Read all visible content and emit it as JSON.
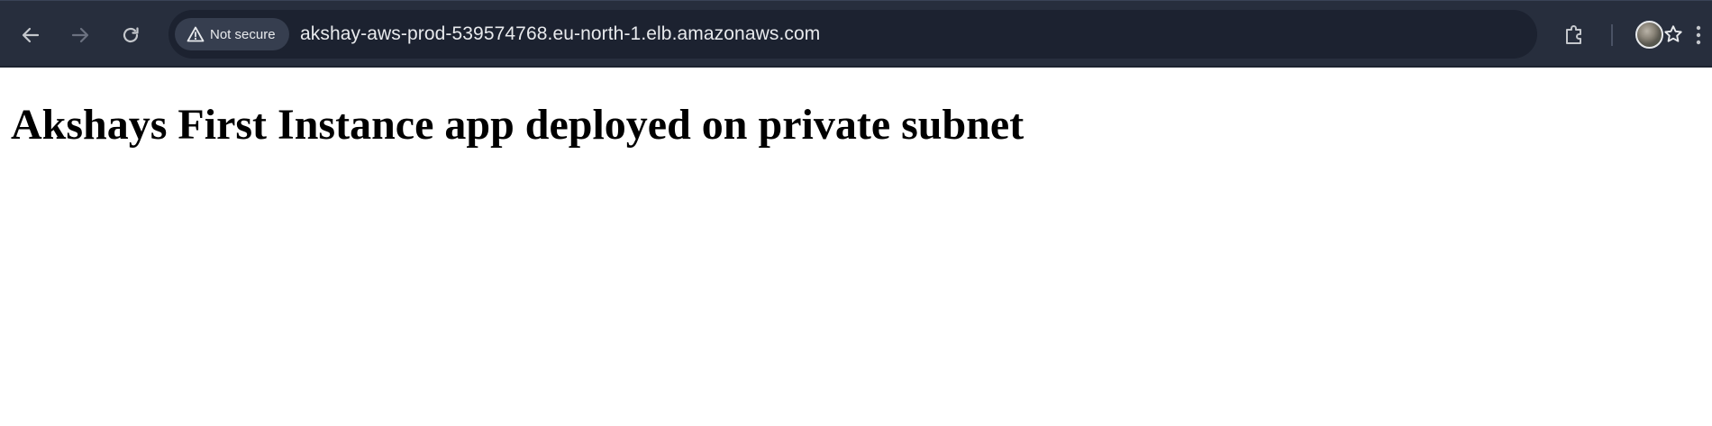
{
  "browser": {
    "security_label": "Not secure",
    "url": "akshay-aws-prod-539574768.eu-north-1.elb.amazonaws.com",
    "icons": {
      "back": "arrow-left-icon",
      "forward": "arrow-right-icon",
      "reload": "reload-icon",
      "security": "warning-triangle-icon",
      "bookmark": "star-icon",
      "extensions": "puzzle-piece-icon",
      "menu": "vertical-dots-icon"
    },
    "colors": {
      "toolbar": "#272e3d",
      "omnibox": "#1c2230",
      "chip": "#363e4f",
      "text": "#e8eaed"
    }
  },
  "page": {
    "heading": "Akshays First Instance app deployed on private subnet"
  }
}
